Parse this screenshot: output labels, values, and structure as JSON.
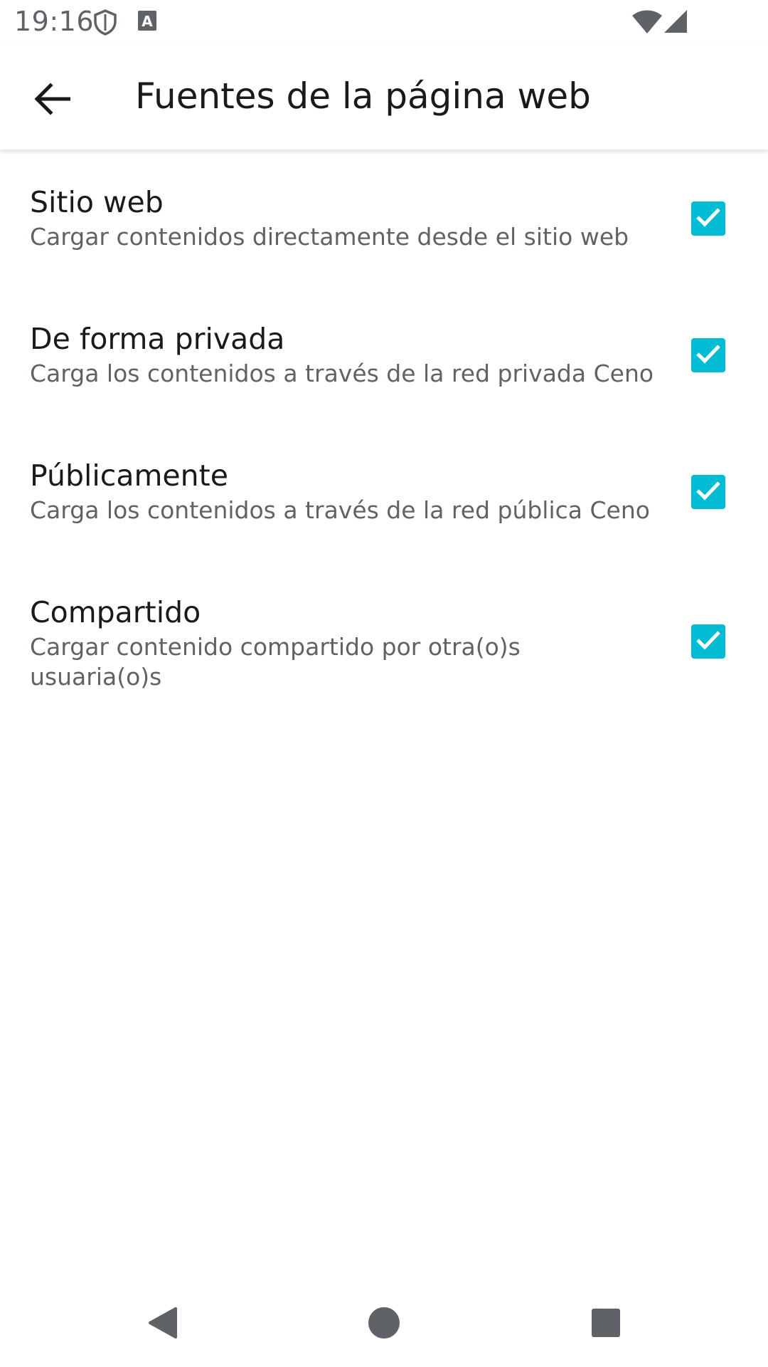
{
  "status_bar": {
    "time": "19:16",
    "icons": [
      "shield-icon",
      "a-notification-icon",
      "wifi-icon",
      "cellular-signal-icon"
    ]
  },
  "app_bar": {
    "title": "Fuentes de la página web",
    "back_icon": "arrow-back-icon"
  },
  "settings": {
    "items": [
      {
        "title": "Sitio web",
        "summary": "Cargar contenidos directamente desde el sitio web",
        "checked": true
      },
      {
        "title": "De forma privada",
        "summary": "Carga los contenidos a través de la red privada Ceno",
        "checked": true
      },
      {
        "title": "Públicamente",
        "summary": "Carga los contenidos a través de la red pública Ceno",
        "checked": true
      },
      {
        "title": "Compartido",
        "summary": "Cargar contenido compartido por otra(o)s usuaria(o)s",
        "checked": true
      }
    ]
  },
  "nav_bar": {
    "icons": [
      "back-triangle-icon",
      "home-circle-icon",
      "recents-square-icon"
    ]
  },
  "colors": {
    "accent": "#00bcd4",
    "title_text": "#1a1a1a",
    "secondary_text": "#5f6368",
    "nav_icon": "#5f6368"
  }
}
